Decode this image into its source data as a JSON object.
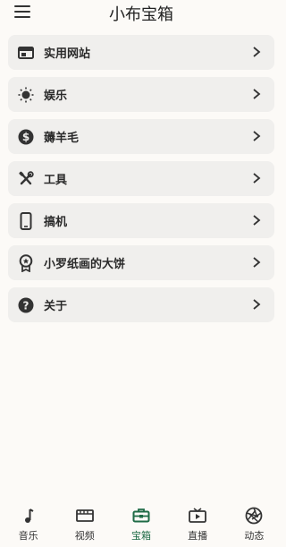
{
  "header": {
    "title": "小布宝箱",
    "menu_icon": "menu-icon"
  },
  "menu": {
    "items": [
      {
        "label": "实用网站",
        "icon": "web-icon"
      },
      {
        "label": "娱乐",
        "icon": "sun-icon"
      },
      {
        "label": "薅羊毛",
        "icon": "dollar-icon"
      },
      {
        "label": "工具",
        "icon": "tools-icon"
      },
      {
        "label": "搞机",
        "icon": "phone-icon"
      },
      {
        "label": "小罗纸画的大饼",
        "icon": "award-icon"
      },
      {
        "label": "关于",
        "icon": "help-icon"
      }
    ]
  },
  "tabbar": {
    "active_index": 2,
    "active_color": "#1e6b46",
    "tabs": [
      {
        "label": "音乐",
        "icon": "music-icon"
      },
      {
        "label": "视频",
        "icon": "film-icon"
      },
      {
        "label": "宝箱",
        "icon": "toolbox-icon"
      },
      {
        "label": "直播",
        "icon": "tv-icon"
      },
      {
        "label": "动态",
        "icon": "aperture-icon"
      }
    ]
  }
}
